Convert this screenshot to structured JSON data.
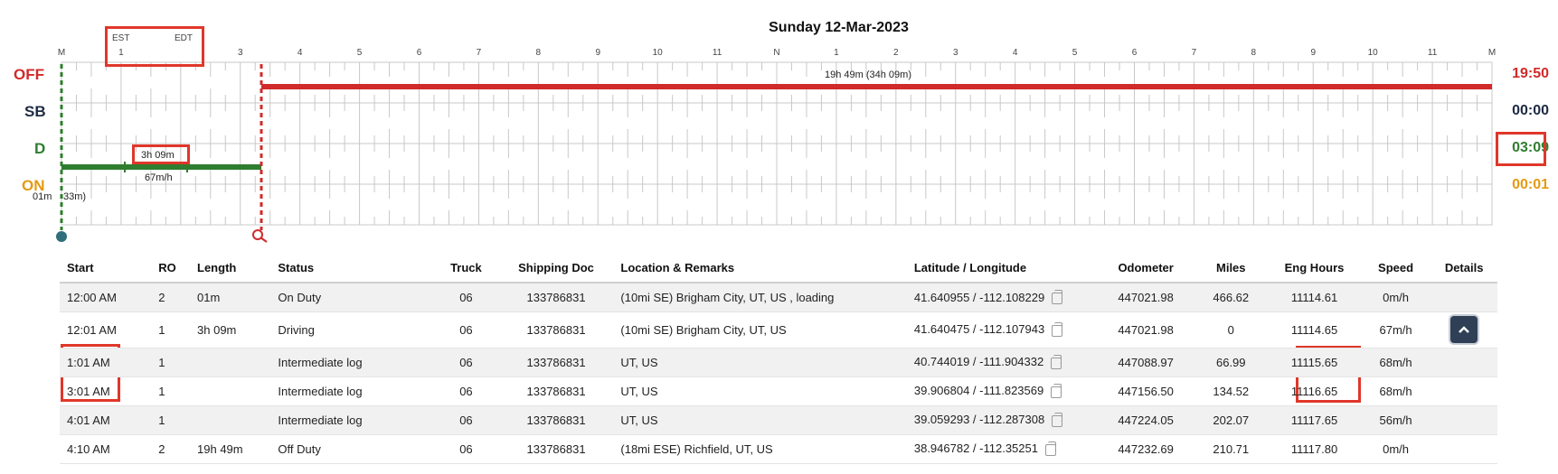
{
  "title": "Sunday 12-Mar-2023",
  "timezones": {
    "left": "EST",
    "right": "EDT"
  },
  "hour_labels": [
    "M",
    "1",
    "3",
    "4",
    "5",
    "6",
    "7",
    "8",
    "9",
    "10",
    "11",
    "N",
    "1",
    "2",
    "3",
    "4",
    "5",
    "6",
    "7",
    "8",
    "9",
    "10",
    "11",
    "M"
  ],
  "status_rows": [
    {
      "code": "OFF",
      "total": "19:50",
      "color": "#d12a2a"
    },
    {
      "code": "SB",
      "total": "00:00",
      "color": "#1d2b44"
    },
    {
      "code": "D",
      "total": "03:09",
      "color": "#2f7d2f"
    },
    {
      "code": "ON",
      "total": "00:01",
      "color": "#e59a13"
    }
  ],
  "graph_annotations": {
    "off_duration": "19h 49m (34h 09m)",
    "driving_duration": "3h 09m",
    "driving_speed": "67m/h",
    "on_duration_a": "01m",
    "on_duration_b": "33m)"
  },
  "table": {
    "columns": [
      "Start",
      "RO",
      "Length",
      "Status",
      "Truck",
      "Shipping Doc",
      "Location & Remarks",
      "Latitude / Longitude",
      "Odometer",
      "Miles",
      "Eng Hours",
      "Speed",
      "Details"
    ],
    "rows": [
      {
        "start": "12:00 AM",
        "ro": "2",
        "length": "01m",
        "status": "On Duty",
        "truck": "06",
        "shipping": "133786831",
        "location": "(10mi SE) Brigham City, UT, US , loading",
        "latlng": "41.640955 / -112.108229",
        "odometer": "447021.98",
        "miles": "466.62",
        "eng": "11114.61",
        "speed": "0m/h"
      },
      {
        "start": "12:01 AM",
        "ro": "1",
        "length": "3h 09m",
        "status": "Driving",
        "truck": "06",
        "shipping": "133786831",
        "location": "(10mi SE) Brigham City, UT, US",
        "latlng": "41.640475 / -112.107943",
        "odometer": "447021.98",
        "miles": "0",
        "eng": "11114.65",
        "speed": "67m/h"
      },
      {
        "start": "1:01 AM",
        "ro": "1",
        "length": "",
        "status": "Intermediate log",
        "truck": "06",
        "shipping": "133786831",
        "location": "UT, US",
        "latlng": "40.744019 / -111.904332",
        "odometer": "447088.97",
        "miles": "66.99",
        "eng": "11115.65",
        "speed": "68m/h"
      },
      {
        "start": "3:01 AM",
        "ro": "1",
        "length": "",
        "status": "Intermediate log",
        "truck": "06",
        "shipping": "133786831",
        "location": "UT, US",
        "latlng": "39.906804 / -111.823569",
        "odometer": "447156.50",
        "miles": "134.52",
        "eng": "11116.65",
        "speed": "68m/h"
      },
      {
        "start": "4:01 AM",
        "ro": "1",
        "length": "",
        "status": "Intermediate log",
        "truck": "06",
        "shipping": "133786831",
        "location": "UT, US",
        "latlng": "39.059293 / -112.287308",
        "odometer": "447224.05",
        "miles": "202.07",
        "eng": "11117.65",
        "speed": "56m/h"
      },
      {
        "start": "4:10 AM",
        "ro": "2",
        "length": "19h 49m",
        "status": "Off Duty",
        "truck": "06",
        "shipping": "133786831",
        "location": "(18mi ESE) Richfield, UT, US",
        "latlng": "38.946782 / -112.35251",
        "odometer": "447232.69",
        "miles": "210.71",
        "eng": "11117.80",
        "speed": "0m/h"
      }
    ]
  }
}
